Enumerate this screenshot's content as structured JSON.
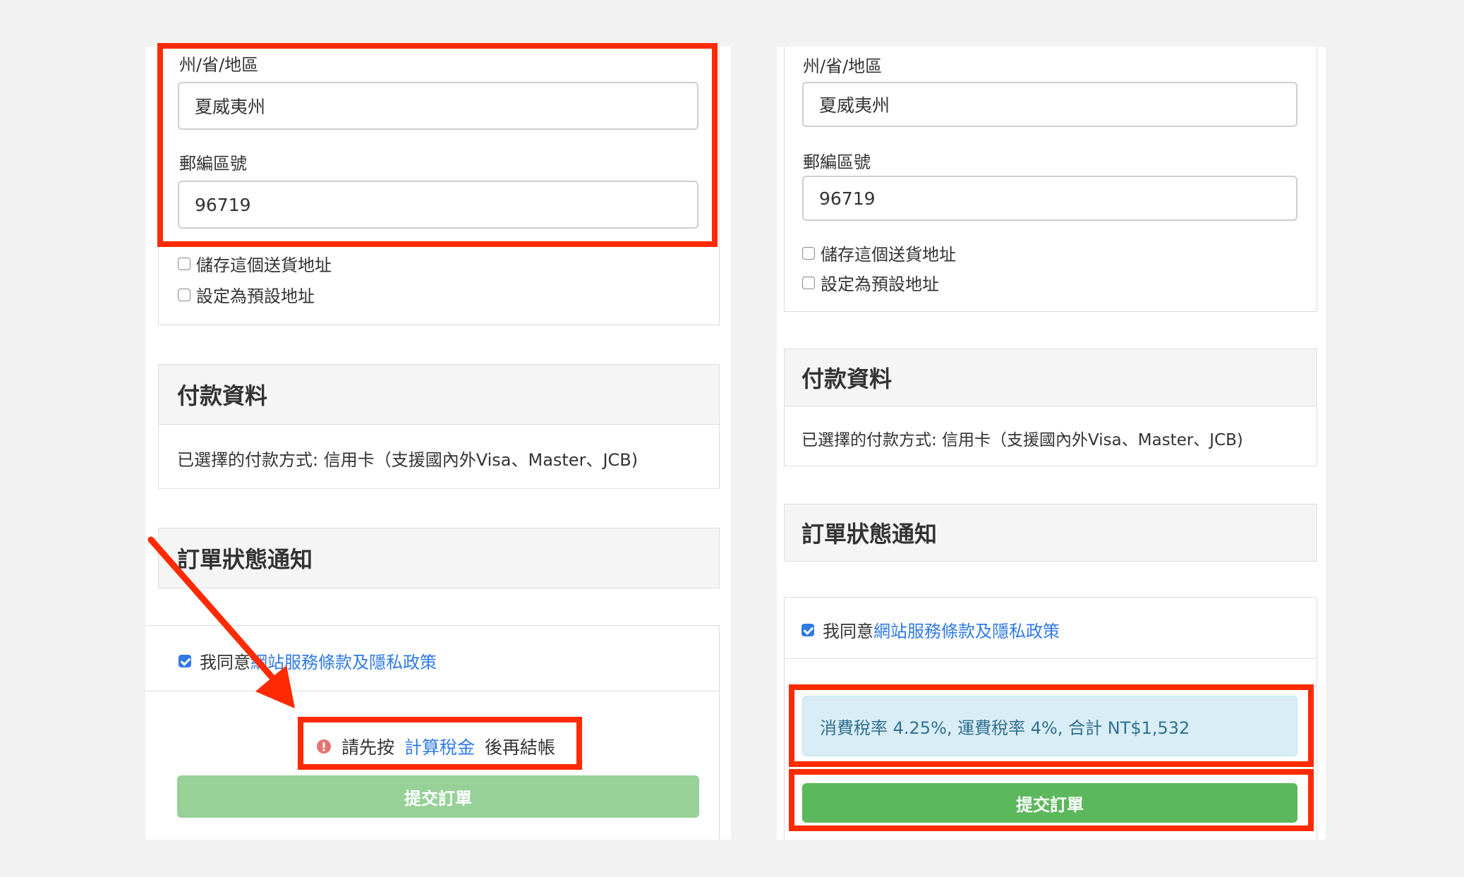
{
  "left": {
    "state_label": "州/省/地區",
    "state_value": "夏威夷州",
    "zip_label": "郵編區號",
    "zip_value": "96719",
    "save_address": "儲存這個送貨地址",
    "set_default": "設定為預設地址",
    "payment_heading": "付款資料",
    "payment_method": "已選擇的付款方式: 信用卡（支援國內外Visa、Master、JCB)",
    "notify_heading": "訂單狀態通知",
    "agree_prefix": "我同意",
    "agree_link": "網站服務條款及隱私政策",
    "warn_prefix": "請先按",
    "warn_link": "計算稅金",
    "warn_suffix": "後再結帳",
    "submit": "提交訂單"
  },
  "right": {
    "state_label": "州/省/地區",
    "state_value": "夏威夷州",
    "zip_label": "郵編區號",
    "zip_value": "96719",
    "save_address": "儲存這個送貨地址",
    "set_default": "設定為預設地址",
    "payment_heading": "付款資料",
    "payment_method": "已選擇的付款方式: 信用卡（支援國內外Visa、Master、JCB)",
    "notify_heading": "訂單狀態通知",
    "agree_prefix": "我同意",
    "agree_link": "網站服務條款及隱私政策",
    "tax_info": "消費稅率 4.25%, 運費稅率 4%, 合計 NT$1,532",
    "submit": "提交訂單"
  },
  "colors": {
    "annotation_red": "#ff2a00",
    "submit_disabled": "#97d197",
    "submit_enabled": "#5cb85c",
    "link": "#2f7ae5",
    "tax_info_bg": "#d9edf7"
  },
  "icons": [
    "alert-circle-icon",
    "checkbox-icon",
    "arrow-annotation"
  ]
}
